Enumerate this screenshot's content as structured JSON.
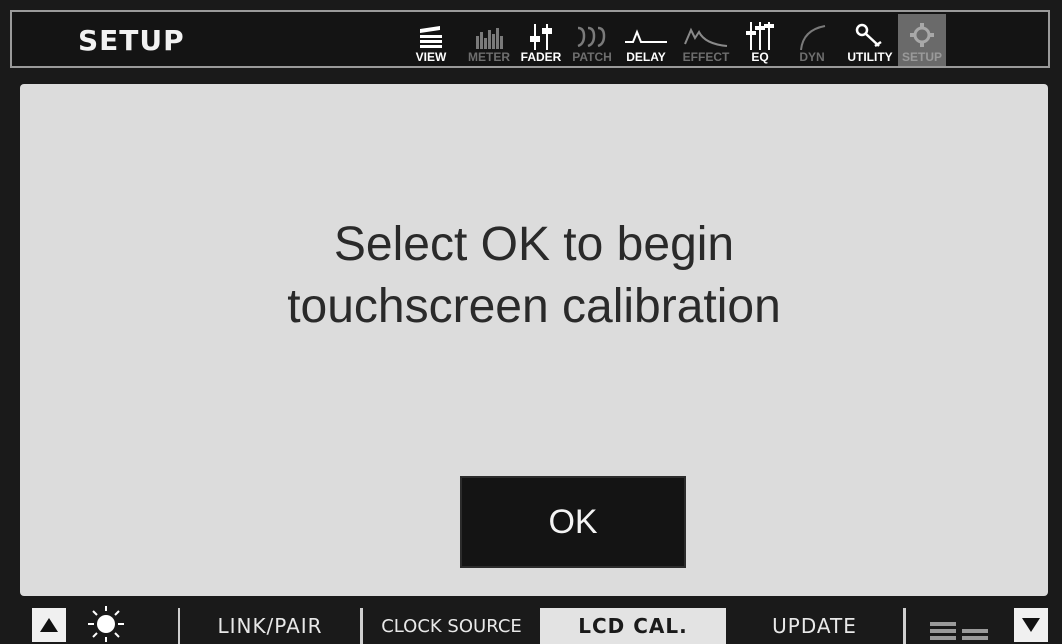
{
  "header": {
    "title": "SETUP",
    "nav": [
      {
        "label": "VIEW",
        "icon": "view-icon",
        "state": "bright"
      },
      {
        "label": "METER",
        "icon": "meter-icon",
        "state": "dim"
      },
      {
        "label": "FADER",
        "icon": "fader-icon",
        "state": "bright"
      },
      {
        "label": "PATCH",
        "icon": "patch-icon",
        "state": "dim"
      },
      {
        "label": "DELAY",
        "icon": "delay-icon",
        "state": "bright"
      },
      {
        "label": "EFFECT",
        "icon": "effect-icon",
        "state": "dim"
      },
      {
        "label": "EQ",
        "icon": "eq-icon",
        "state": "bright"
      },
      {
        "label": "DYN",
        "icon": "dyn-icon",
        "state": "dim"
      },
      {
        "label": "UTILITY",
        "icon": "wrench-icon",
        "state": "bright"
      },
      {
        "label": "SETUP",
        "icon": "gear-icon",
        "state": "active"
      }
    ]
  },
  "main": {
    "message_line1": "Select OK to begin",
    "message_line2": "touchscreen calibration",
    "ok_label": "OK"
  },
  "footer": {
    "left_arrow_icon": "triangle-up-icon",
    "brightness_icon": "sun-icon",
    "tabs": [
      {
        "label": "LINK/PAIR",
        "selected": false
      },
      {
        "label": "CLOCK SOURCE",
        "selected": false
      },
      {
        "label": "LCD CAL.",
        "selected": true
      },
      {
        "label": "UPDATE",
        "selected": false
      }
    ],
    "menu_icon": "menu-bars-icon",
    "right_arrow_icon": "triangle-down-icon"
  },
  "colors": {
    "background": "#1a1a1a",
    "panel": "#dcdcdc",
    "button": "#141414",
    "selected_tab": "#e3e3e3",
    "active_nav": "#6a6a6a"
  }
}
